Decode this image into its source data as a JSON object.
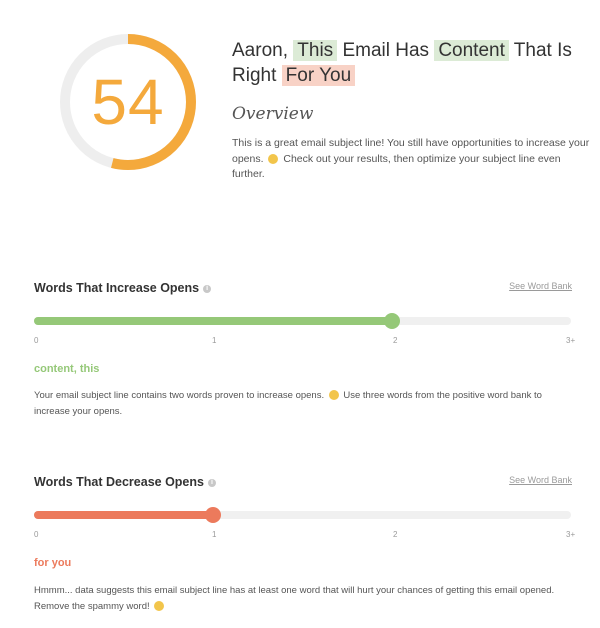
{
  "score": {
    "value": "54",
    "fraction": 0.54,
    "ring_color": "#f4a93c",
    "track_color": "#eeeeee"
  },
  "headline": {
    "part1": "Aaron, ",
    "hl1": "This",
    "part2": " Email Has ",
    "hl2": "Content",
    "part3": " That Is Right ",
    "hl3": "For You"
  },
  "overview": {
    "title": "Overview",
    "text_a": "This is a great email subject line! You still have opportunities to increase your opens.",
    "text_b": "Check out your results, then optimize your subject line even further.",
    "emoji": "smiley-emoji"
  },
  "increase": {
    "title": "Words That Increase Opens",
    "wordbank": "See Word Bank",
    "ticks": [
      "0",
      "1",
      "2",
      "3+"
    ],
    "level": 2,
    "max": 3,
    "color": "#95c878",
    "words": "content, this",
    "text_a": "Your email subject line contains two words proven to increase opens.",
    "text_b": "Use three words from the positive word bank to increase your opens."
  },
  "decrease": {
    "title": "Words That Decrease Opens",
    "wordbank": "See Word Bank",
    "ticks": [
      "0",
      "1",
      "2",
      "3+"
    ],
    "level": 1,
    "max": 3,
    "color": "#ec7a5c",
    "words": "for you",
    "text_a": "Hmmm... data suggests this email subject line has at least one word that will hurt your chances of getting this email opened. Remove the spammy word!"
  }
}
